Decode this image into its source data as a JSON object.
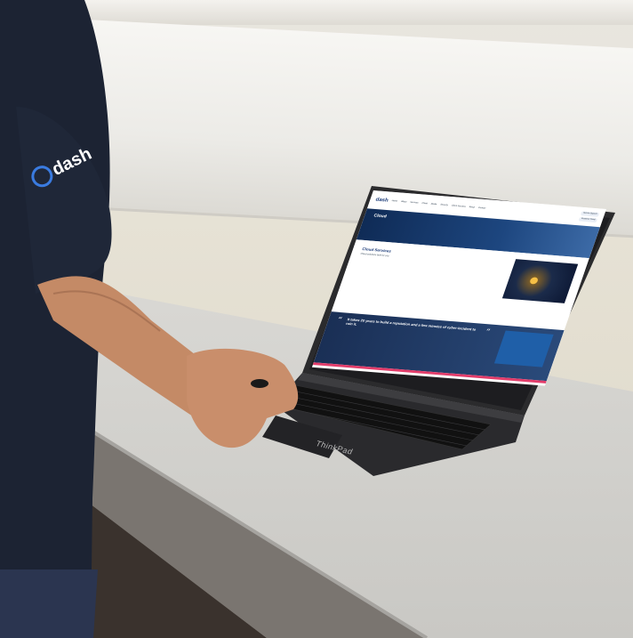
{
  "shirt_logo": "dash",
  "laptop_brand": "ThinkPad",
  "website": {
    "logo": "dash",
    "nav_items": [
      "Home",
      "About",
      "Services",
      "Cloud",
      "Media",
      "Security",
      "Client Success",
      "About",
      "Contact"
    ],
    "nav_pills": [
      "Service Support",
      "Customer Portal",
      "contact@dash.co.uk",
      "Sales: 02 3456"
    ],
    "hero_title": "Cloud",
    "section_title": "Cloud Services",
    "section_sub": "Cloud solutions built for you",
    "quote": "It takes 20 years to build a reputation and a few minutes of cyber-incident to ruin it."
  }
}
